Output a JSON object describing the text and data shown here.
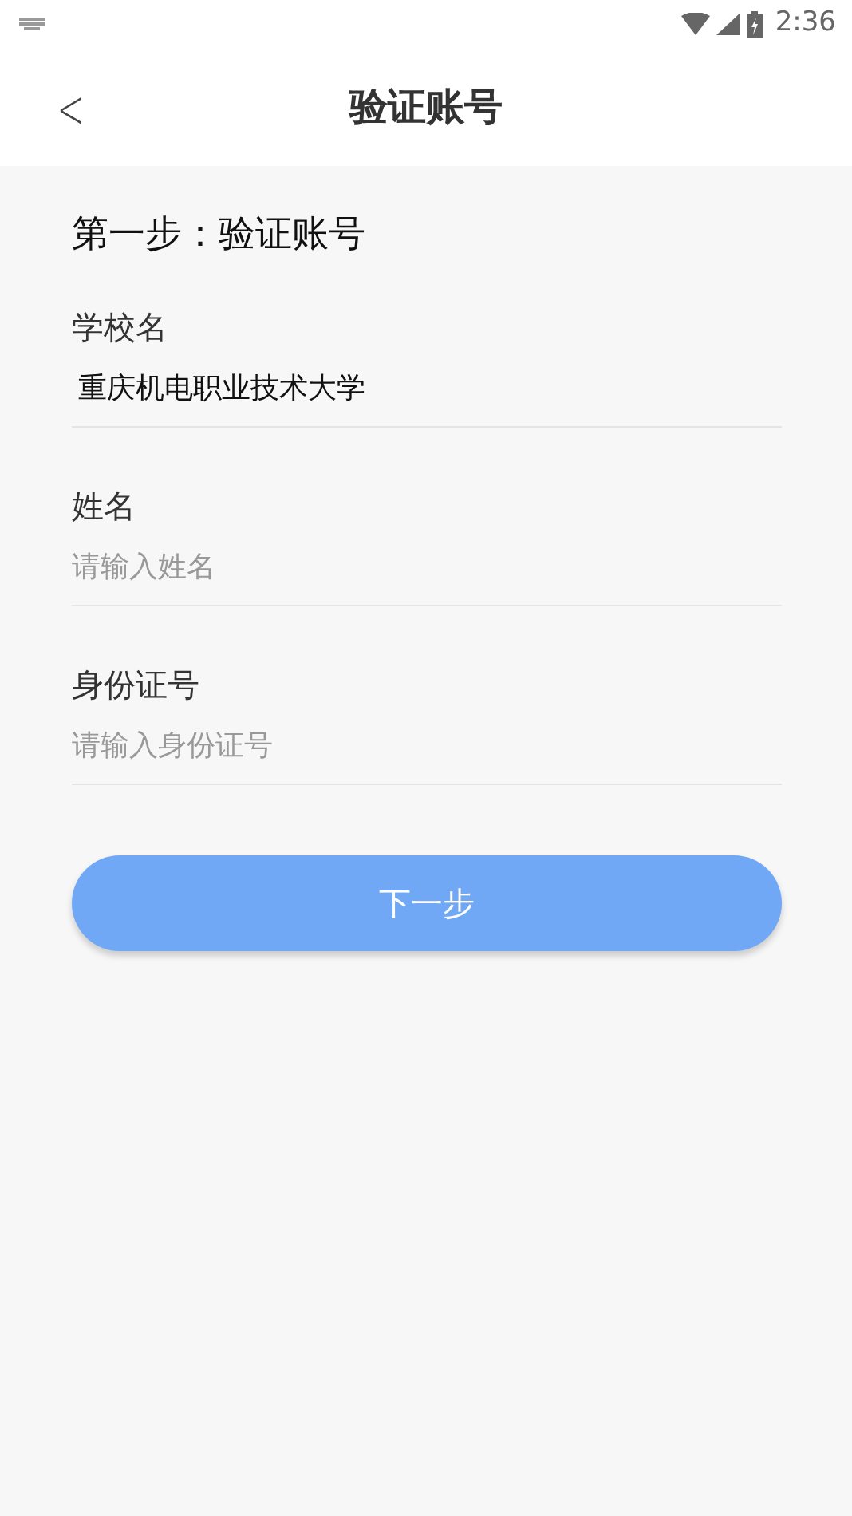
{
  "status_bar": {
    "time": "2:36"
  },
  "header": {
    "back": "<",
    "title": "验证账号"
  },
  "step_title": "第一步：验证账号",
  "fields": [
    {
      "label": "学校名",
      "value": "重庆机电职业技术大学"
    },
    {
      "label": "姓名",
      "placeholder": "请输入姓名"
    },
    {
      "label": "身份证号",
      "placeholder": "请输入身份证号"
    }
  ],
  "next_button": "下一步"
}
